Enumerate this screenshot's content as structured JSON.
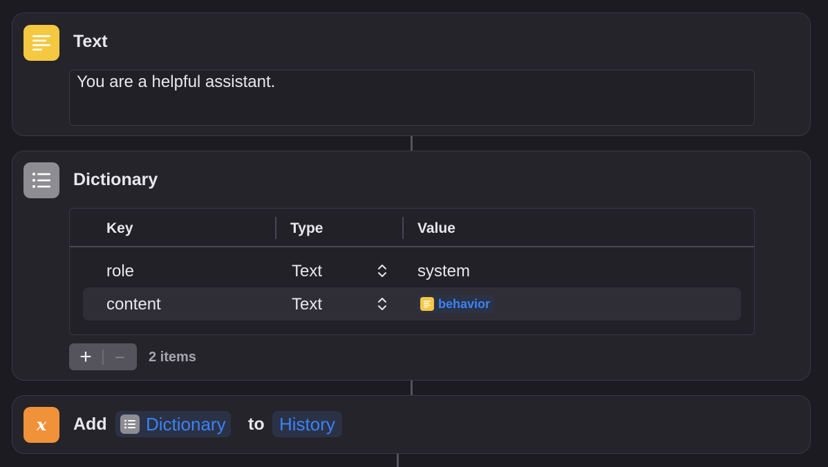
{
  "actions": {
    "text_action": {
      "title": "Text",
      "icon": "text-lines-icon",
      "icon_color": "#f5c842",
      "content": "You are a helpful assistant."
    },
    "dictionary_action": {
      "title": "Dictionary",
      "icon": "list-icon",
      "icon_color": "#8e8d93",
      "columns": {
        "key": "Key",
        "type": "Type",
        "value": "Value"
      },
      "rows": [
        {
          "key": "role",
          "type": "Text",
          "value": "system"
        },
        {
          "key": "content",
          "type": "Text",
          "value": "behavior",
          "value_is_variable": true,
          "variable_icon": "text-lines-icon"
        }
      ],
      "add_button": "+",
      "remove_button": "−",
      "count_label": "2 items"
    },
    "add_to_variable_action": {
      "icon": "variable-x-icon",
      "icon_color": "#f0923a",
      "verb": "Add",
      "input_token": "Dictionary",
      "input_token_icon": "list-icon",
      "preposition": "to",
      "variable_token": "History"
    }
  },
  "colors": {
    "variable_token_text": "#3b82f6",
    "variable_token_bg": "#2b3246"
  }
}
